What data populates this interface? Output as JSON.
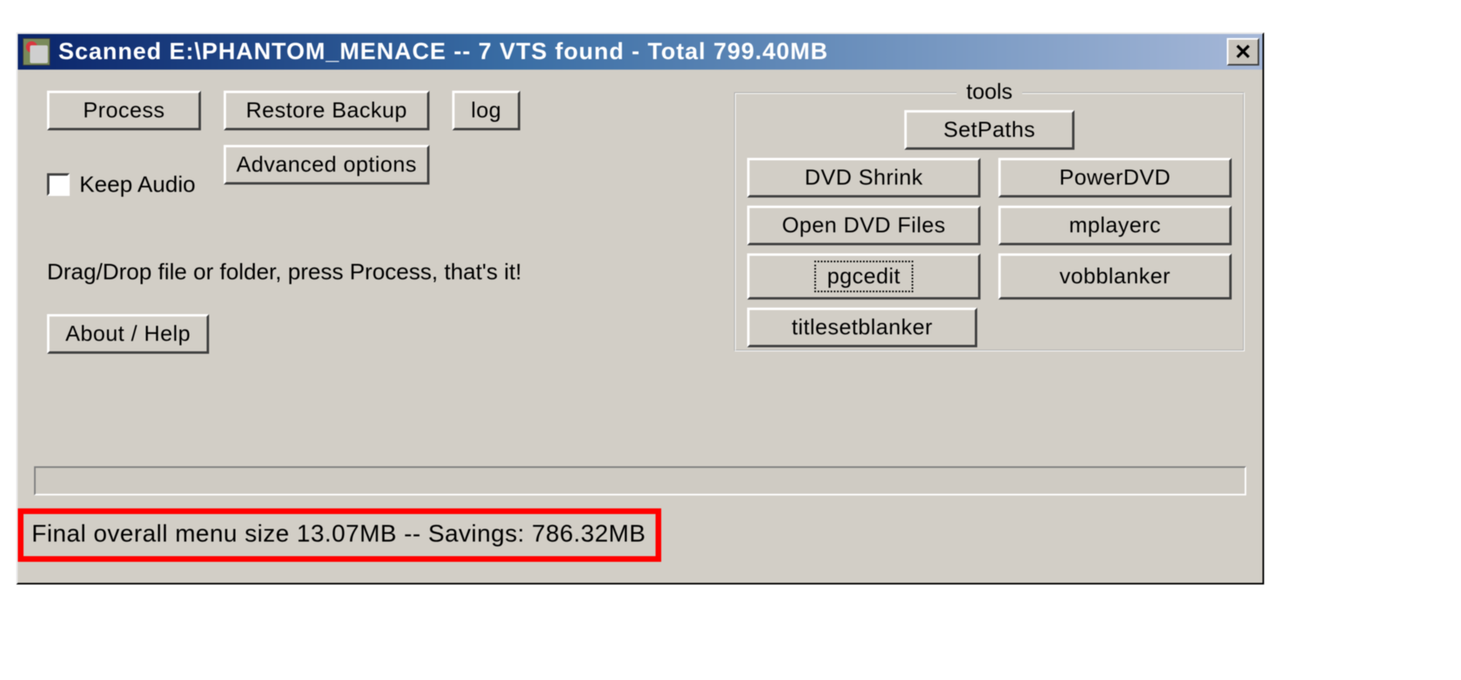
{
  "window": {
    "title": "Scanned E:\\PHANTOM_MENACE -- 7 VTS found - Total 799.40MB"
  },
  "main": {
    "process_button": "Process",
    "restore_backup_button": "Restore Backup",
    "log_button": "log",
    "advanced_options_button": "Advanced options",
    "keep_audio_label": "Keep Audio",
    "keep_audio_checked": false,
    "hint_text": "Drag/Drop file or folder, press Process, that's it!",
    "about_button": "About / Help"
  },
  "tools": {
    "group_label": "tools",
    "setpaths": "SetPaths",
    "buttons": [
      [
        "DVD Shrink",
        "PowerDVD"
      ],
      [
        "Open DVD Files",
        "mplayerc"
      ],
      [
        "pgcedit",
        "vobblanker"
      ],
      [
        "titlesetblanker",
        null
      ]
    ],
    "focused": "pgcedit"
  },
  "status": {
    "text": "Final overall menu size 13.07MB -- Savings: 786.32MB"
  }
}
